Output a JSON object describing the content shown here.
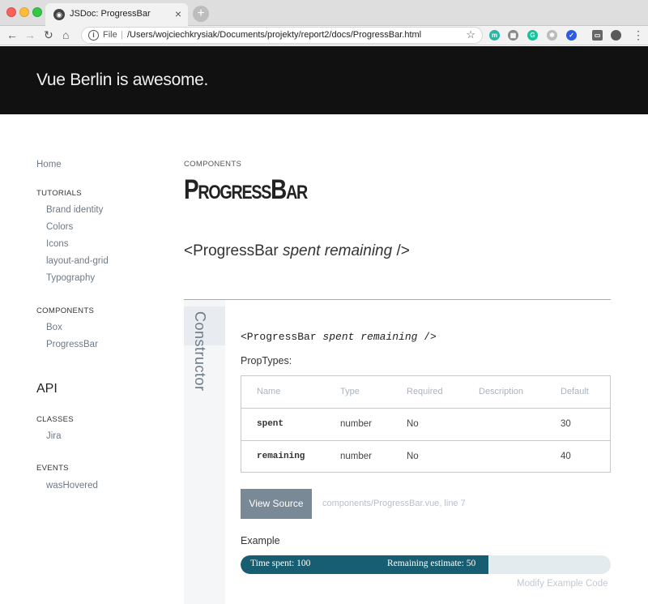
{
  "browser": {
    "tab_title": "JSDoc: ProgressBar",
    "tab_close": "×",
    "new_tab": "+",
    "url_scheme": "File",
    "url_separator": "|",
    "url": "/Users/wojciechkrysiak/Documents/projekty/report2/docs/ProgressBar.html",
    "nav_back": "←",
    "nav_forward": "→",
    "nav_reload": "↻",
    "nav_home": "⌂",
    "bookmark": "☆",
    "menu": "⋮",
    "extensions": [
      {
        "name": "m-extension-icon",
        "glyph": "m",
        "color": "#2bb5a6"
      },
      {
        "name": "layout-extension-icon",
        "glyph": "▦",
        "color": "#888888"
      },
      {
        "name": "grammarly-icon",
        "glyph": "G",
        "color": "#15c39a"
      },
      {
        "name": "puzzle-extension-icon",
        "glyph": "✱",
        "color": "#bbbbbb"
      },
      {
        "name": "check-extension-icon",
        "glyph": "✓",
        "color": "#2d5be3"
      },
      {
        "name": "cast-icon",
        "glyph": "▭",
        "color": "#666666"
      }
    ]
  },
  "header": {
    "title": "Vue Berlin is awesome."
  },
  "sidebar": {
    "home": "Home",
    "tutorials_heading": "TUTORIALS",
    "tutorials": [
      "Brand identity",
      "Colors",
      "Icons",
      "layout-and-grid",
      "Typography"
    ],
    "components_heading": "COMPONENTS",
    "components": [
      "Box",
      "ProgressBar"
    ],
    "api_heading": "API",
    "classes_heading": "CLASSES",
    "classes": [
      "Jira"
    ],
    "events_heading": "EVENTS",
    "events": [
      "wasHovered"
    ]
  },
  "main": {
    "kicker": "COMPONENTS",
    "title": "ProgressBar",
    "signature_open": "<ProgressBar ",
    "signature_params": "spent remaining",
    "signature_close": " />",
    "constructor_label": "Constructor",
    "code_open": "<ProgressBar ",
    "code_params": "spent remaining",
    "code_close": " />",
    "proptypes_label": "PropTypes:",
    "table": {
      "headers": [
        "Name",
        "Type",
        "Required",
        "Description",
        "Default"
      ],
      "rows": [
        {
          "name": "spent",
          "type": "number",
          "required": "No",
          "description": "",
          "default": "30"
        },
        {
          "name": "remaining",
          "type": "number",
          "required": "No",
          "description": "",
          "default": "40"
        }
      ]
    },
    "view_source_label": "View Source",
    "source_file": "components/ProgressBar.vue",
    "source_line": ", line 7",
    "example_label": "Example",
    "progress": {
      "spent_text": "Time spent: 100",
      "remaining_text": "Remaining estimate: 50",
      "fraction": 0.67,
      "fill_color": "#185e72",
      "track_color": "#e3ebef"
    },
    "modify_link": "Modify Example Code"
  }
}
